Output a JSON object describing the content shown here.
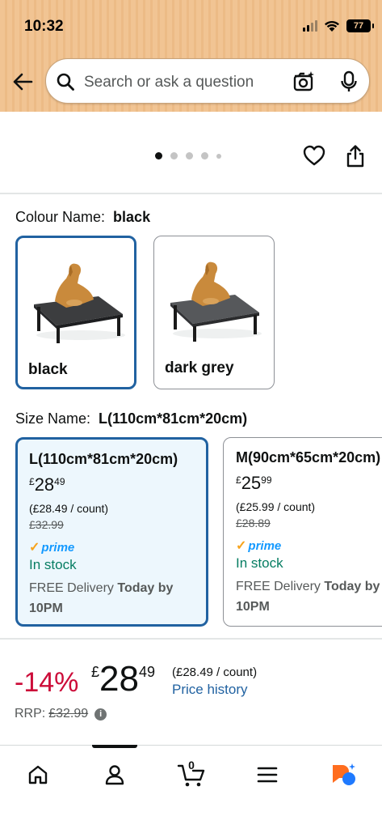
{
  "status_bar": {
    "time": "10:32",
    "battery": "77"
  },
  "search": {
    "placeholder": "Search or ask a question"
  },
  "gallery": {
    "image_count": 5,
    "active_index": 0
  },
  "colour": {
    "label": "Colour Name:",
    "selected_value": "black",
    "options": [
      {
        "name": "black",
        "selected": true
      },
      {
        "name": "dark grey",
        "selected": false
      }
    ]
  },
  "size": {
    "label": "Size Name:",
    "selected_value": "L(110cm*81cm*20cm)",
    "options": [
      {
        "title": "L(110cm*81cm*20cm)",
        "currency": "£",
        "price_whole": "28",
        "price_fraction": "49",
        "unit_price": "(£28.49 / count)",
        "rrp": "£32.99",
        "prime": "prime",
        "stock": "In stock",
        "delivery_prefix": "FREE Delivery",
        "delivery_bold": "Today by",
        "delivery_time": "10PM",
        "selected": true
      },
      {
        "title": "M(90cm*65cm*20cm)",
        "currency": "£",
        "price_whole": "25",
        "price_fraction": "99",
        "unit_price": "(£25.99 / count)",
        "rrp": "£28.89",
        "prime": "prime",
        "stock": "In stock",
        "delivery_prefix": "FREE Delivery",
        "delivery_bold": "Today by",
        "delivery_time": "10PM",
        "selected": false
      }
    ]
  },
  "price": {
    "discount": "-14%",
    "currency": "£",
    "whole": "28",
    "fraction": "49",
    "unit_price": "(£28.49 / count)",
    "history_link": "Price history",
    "rrp_label": "RRP:",
    "rrp_value": "£32.99"
  },
  "bottom_nav": {
    "items": [
      "home-icon",
      "account-icon",
      "cart-icon",
      "menu-icon",
      "rufus-icon"
    ],
    "cart_count": "0"
  },
  "colors": {
    "header": "#f1c493",
    "selected_border": "#2162a1",
    "discount": "#cc0c39",
    "stock": "#067d62",
    "prime": "#1399ff",
    "link": "#2162a1"
  }
}
